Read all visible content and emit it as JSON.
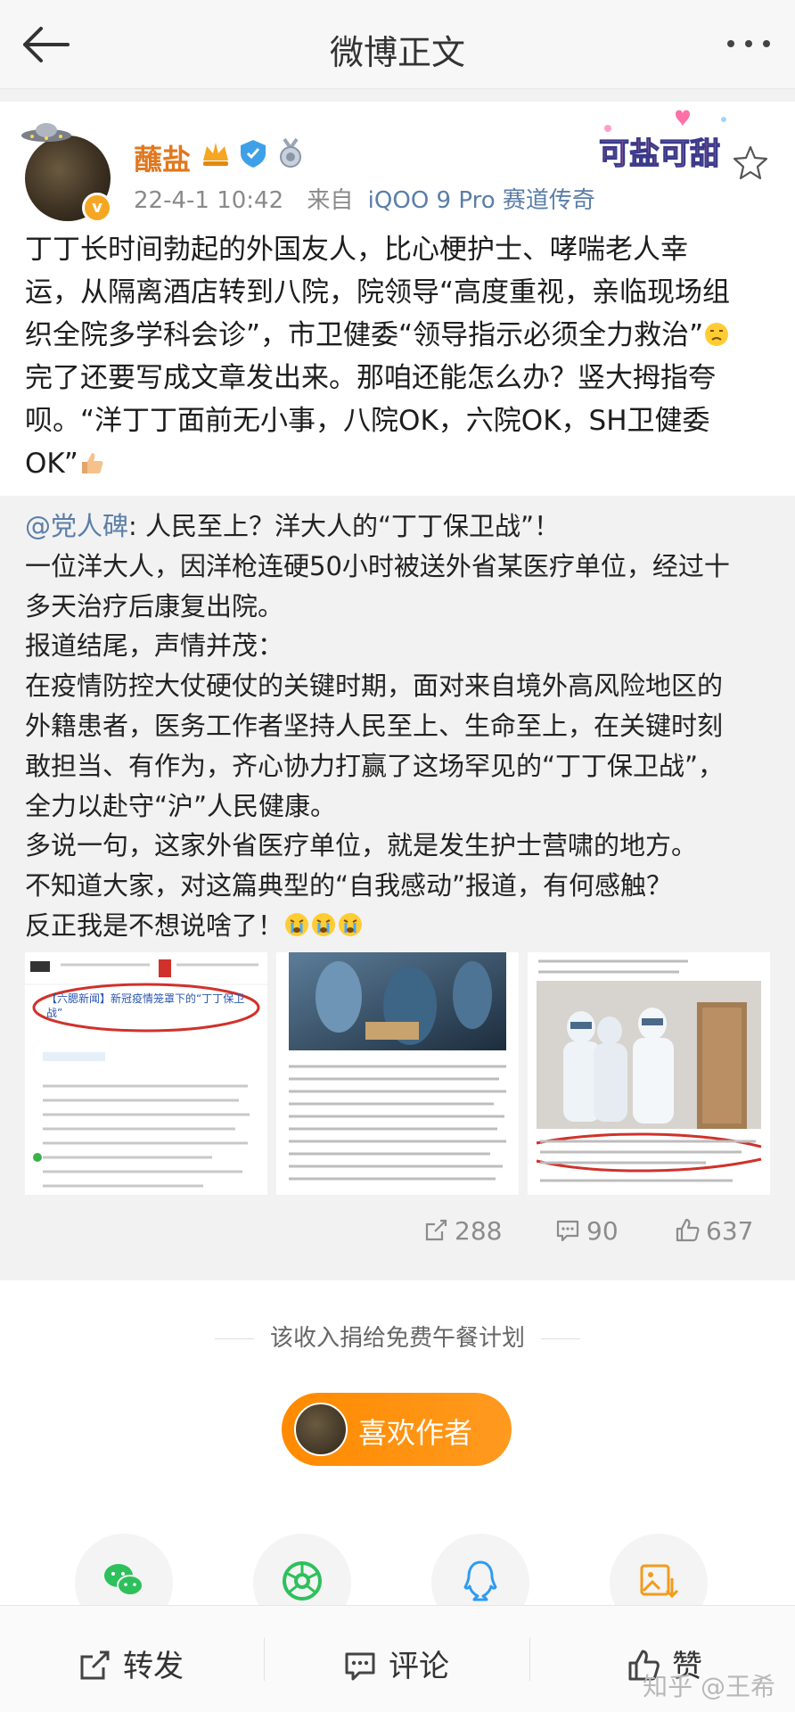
{
  "header": {
    "title": "微博正文"
  },
  "post": {
    "author_name": "蘸盐",
    "timestamp": "22-4-1 10:42",
    "source_prefix": "来自",
    "source": "iQOO 9 Pro 赛道传奇",
    "sticker_text": "可盐可甜",
    "body_lines": [
      "丁丁长时间勃起的外国友人，比心梗护士、哮喘老人幸",
      "运，从隔离酒店转到八院，院领导“高度重视，亲临现场组",
      "织全院多学科会诊”，市卫健委“领导指示必须全力救治”",
      "完了还要写成文章发出来。那咱还能怎么办？竖大拇指夸",
      "呗。“洋丁丁面前无小事，八院OK，六院OK，SH卫健委",
      "OK”"
    ]
  },
  "repost": {
    "mention": "@党人碑",
    "first_line_rest": ": 人民至上？洋大人的“丁丁保卫战”！",
    "lines": [
      "一位洋大人，因洋枪连硬50小时被送外省某医疗单位，经过十",
      "多天治疗后康复出院。",
      "报道结尾，声情并茂：",
      "在疫情防控大仗硬仗的关键时期，面对来自境外高风险地区的",
      "外籍患者，医务工作者坚持人民至上、生命至上，在关键时刻",
      "敢担当、有作为，齐心协力打赢了这场罕见的“丁丁保卫战”，",
      "全力以赴守“沪”人民健康。",
      "多说一句，这家外省医疗单位，就是发生护士营啸的地方。",
      "不知道大家，对这篇典型的“自我感动”报道，有何感触？",
      "反正我是不想说啥了！"
    ],
    "image1_caption": "【六腮新闻】新冠疫情笼罩下的“丁丁保卫战”",
    "stats": {
      "reposts": "288",
      "comments": "90",
      "likes": "637"
    }
  },
  "donation_text": "该收入捐给免费午餐计划",
  "like_author_label": "喜欢作者",
  "bottom_bar": {
    "repost": "转发",
    "comment": "评论",
    "like": "赞"
  },
  "watermark": "知乎 @王希",
  "icons": [
    "back-icon",
    "more-icon",
    "star-icon",
    "repost-icon",
    "comment-icon",
    "like-icon",
    "wechat-icon",
    "moments-icon",
    "qq-icon",
    "save-image-icon"
  ],
  "colors": {
    "accent_orange": "#ff8a00",
    "author_name": "#e0781f",
    "link_blue": "#5b7ea8",
    "muted": "#8a8a8a"
  }
}
